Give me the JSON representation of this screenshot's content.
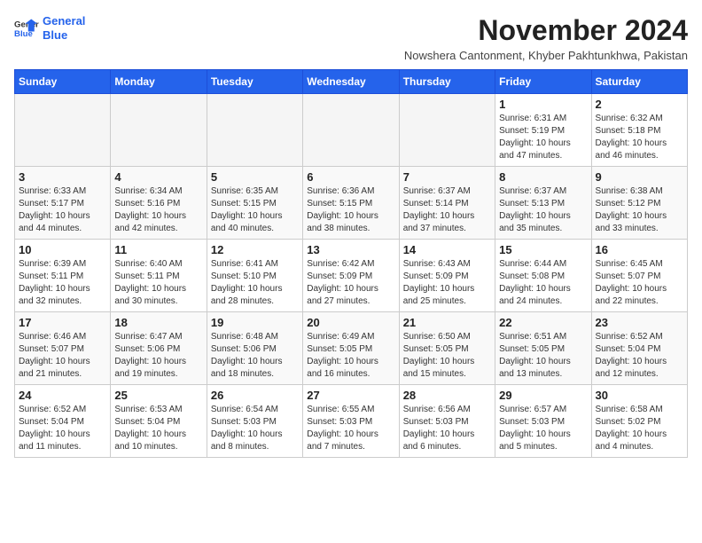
{
  "logo": {
    "line1": "General",
    "line2": "Blue"
  },
  "header": {
    "month": "November 2024",
    "location": "Nowshera Cantonment, Khyber Pakhtunkhwa, Pakistan"
  },
  "weekdays": [
    "Sunday",
    "Monday",
    "Tuesday",
    "Wednesday",
    "Thursday",
    "Friday",
    "Saturday"
  ],
  "weeks": [
    [
      {
        "day": "",
        "info": ""
      },
      {
        "day": "",
        "info": ""
      },
      {
        "day": "",
        "info": ""
      },
      {
        "day": "",
        "info": ""
      },
      {
        "day": "",
        "info": ""
      },
      {
        "day": "1",
        "info": "Sunrise: 6:31 AM\nSunset: 5:19 PM\nDaylight: 10 hours and 47 minutes."
      },
      {
        "day": "2",
        "info": "Sunrise: 6:32 AM\nSunset: 5:18 PM\nDaylight: 10 hours and 46 minutes."
      }
    ],
    [
      {
        "day": "3",
        "info": "Sunrise: 6:33 AM\nSunset: 5:17 PM\nDaylight: 10 hours and 44 minutes."
      },
      {
        "day": "4",
        "info": "Sunrise: 6:34 AM\nSunset: 5:16 PM\nDaylight: 10 hours and 42 minutes."
      },
      {
        "day": "5",
        "info": "Sunrise: 6:35 AM\nSunset: 5:15 PM\nDaylight: 10 hours and 40 minutes."
      },
      {
        "day": "6",
        "info": "Sunrise: 6:36 AM\nSunset: 5:15 PM\nDaylight: 10 hours and 38 minutes."
      },
      {
        "day": "7",
        "info": "Sunrise: 6:37 AM\nSunset: 5:14 PM\nDaylight: 10 hours and 37 minutes."
      },
      {
        "day": "8",
        "info": "Sunrise: 6:37 AM\nSunset: 5:13 PM\nDaylight: 10 hours and 35 minutes."
      },
      {
        "day": "9",
        "info": "Sunrise: 6:38 AM\nSunset: 5:12 PM\nDaylight: 10 hours and 33 minutes."
      }
    ],
    [
      {
        "day": "10",
        "info": "Sunrise: 6:39 AM\nSunset: 5:11 PM\nDaylight: 10 hours and 32 minutes."
      },
      {
        "day": "11",
        "info": "Sunrise: 6:40 AM\nSunset: 5:11 PM\nDaylight: 10 hours and 30 minutes."
      },
      {
        "day": "12",
        "info": "Sunrise: 6:41 AM\nSunset: 5:10 PM\nDaylight: 10 hours and 28 minutes."
      },
      {
        "day": "13",
        "info": "Sunrise: 6:42 AM\nSunset: 5:09 PM\nDaylight: 10 hours and 27 minutes."
      },
      {
        "day": "14",
        "info": "Sunrise: 6:43 AM\nSunset: 5:09 PM\nDaylight: 10 hours and 25 minutes."
      },
      {
        "day": "15",
        "info": "Sunrise: 6:44 AM\nSunset: 5:08 PM\nDaylight: 10 hours and 24 minutes."
      },
      {
        "day": "16",
        "info": "Sunrise: 6:45 AM\nSunset: 5:07 PM\nDaylight: 10 hours and 22 minutes."
      }
    ],
    [
      {
        "day": "17",
        "info": "Sunrise: 6:46 AM\nSunset: 5:07 PM\nDaylight: 10 hours and 21 minutes."
      },
      {
        "day": "18",
        "info": "Sunrise: 6:47 AM\nSunset: 5:06 PM\nDaylight: 10 hours and 19 minutes."
      },
      {
        "day": "19",
        "info": "Sunrise: 6:48 AM\nSunset: 5:06 PM\nDaylight: 10 hours and 18 minutes."
      },
      {
        "day": "20",
        "info": "Sunrise: 6:49 AM\nSunset: 5:05 PM\nDaylight: 10 hours and 16 minutes."
      },
      {
        "day": "21",
        "info": "Sunrise: 6:50 AM\nSunset: 5:05 PM\nDaylight: 10 hours and 15 minutes."
      },
      {
        "day": "22",
        "info": "Sunrise: 6:51 AM\nSunset: 5:05 PM\nDaylight: 10 hours and 13 minutes."
      },
      {
        "day": "23",
        "info": "Sunrise: 6:52 AM\nSunset: 5:04 PM\nDaylight: 10 hours and 12 minutes."
      }
    ],
    [
      {
        "day": "24",
        "info": "Sunrise: 6:52 AM\nSunset: 5:04 PM\nDaylight: 10 hours and 11 minutes."
      },
      {
        "day": "25",
        "info": "Sunrise: 6:53 AM\nSunset: 5:04 PM\nDaylight: 10 hours and 10 minutes."
      },
      {
        "day": "26",
        "info": "Sunrise: 6:54 AM\nSunset: 5:03 PM\nDaylight: 10 hours and 8 minutes."
      },
      {
        "day": "27",
        "info": "Sunrise: 6:55 AM\nSunset: 5:03 PM\nDaylight: 10 hours and 7 minutes."
      },
      {
        "day": "28",
        "info": "Sunrise: 6:56 AM\nSunset: 5:03 PM\nDaylight: 10 hours and 6 minutes."
      },
      {
        "day": "29",
        "info": "Sunrise: 6:57 AM\nSunset: 5:03 PM\nDaylight: 10 hours and 5 minutes."
      },
      {
        "day": "30",
        "info": "Sunrise: 6:58 AM\nSunset: 5:02 PM\nDaylight: 10 hours and 4 minutes."
      }
    ]
  ]
}
